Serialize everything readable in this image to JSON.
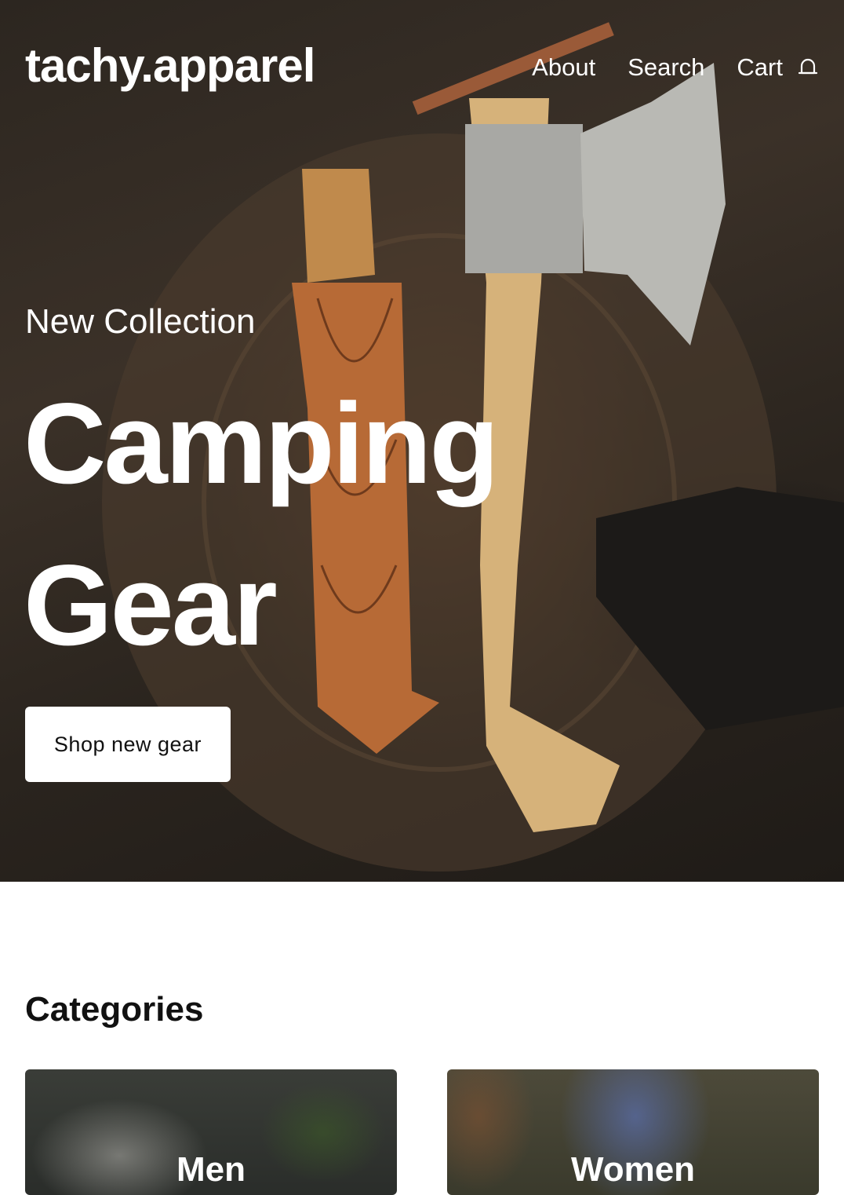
{
  "header": {
    "brand": "tachy.apparel",
    "nav": [
      "About",
      "Search",
      "Cart"
    ],
    "cart_icon": "bell-icon"
  },
  "hero": {
    "eyebrow": "New Collection",
    "headline_line1": "Camping",
    "headline_line2": "Gear",
    "cta_label": "Shop new gear"
  },
  "categories": {
    "title": "Categories",
    "items": [
      {
        "label": "Men"
      },
      {
        "label": "Women"
      }
    ]
  }
}
